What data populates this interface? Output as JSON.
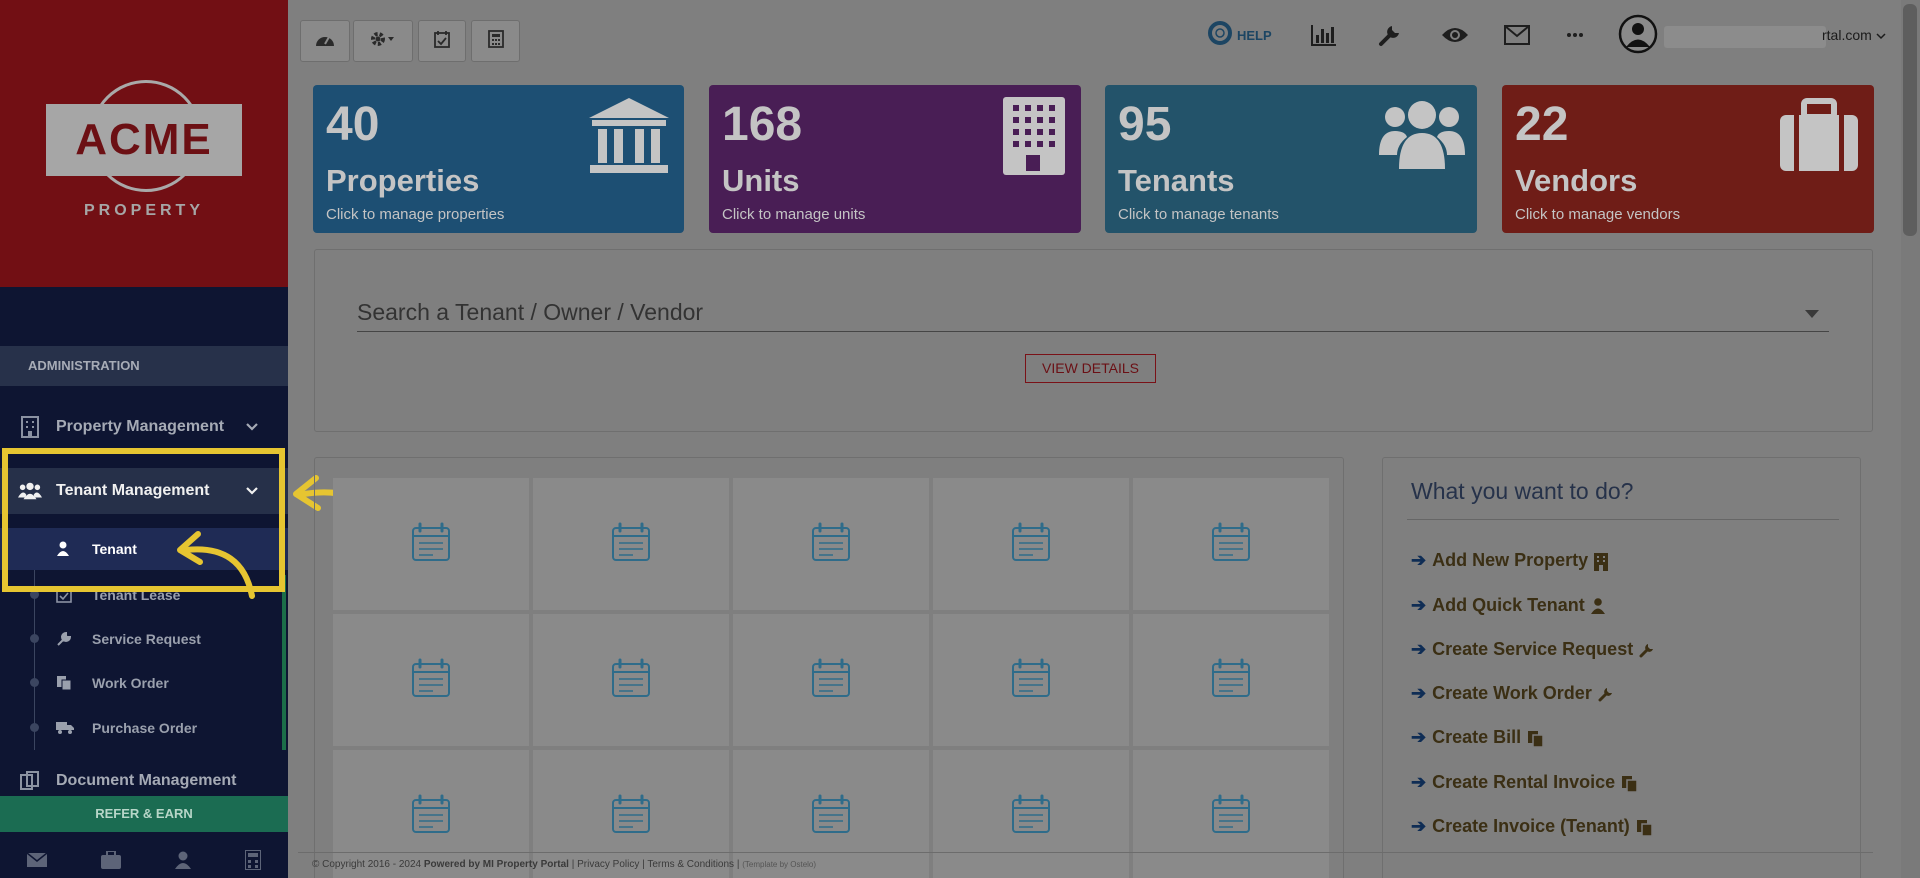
{
  "sidebar": {
    "logo_text": "ACME",
    "logo_sub": "PROPERTY",
    "section_header": "ADMINISTRATION",
    "items": [
      {
        "label": "Property Management"
      },
      {
        "label": "Tenant Management"
      },
      {
        "label": "Document Management"
      }
    ],
    "sub_items": [
      {
        "label": "Tenant"
      },
      {
        "label": "Tenant Lease"
      },
      {
        "label": "Service Request"
      },
      {
        "label": "Work Order"
      },
      {
        "label": "Purchase Order"
      }
    ],
    "refer_label": "REFER & EARN",
    "bottom_icons": [
      "envelope-icon",
      "briefcase-icon",
      "user-icon",
      "calculator-icon"
    ]
  },
  "toolbar": {
    "buttons": [
      "dashboard-icon",
      "gear-dropdown-icon",
      "calendar-check-icon",
      "calculator-icon"
    ]
  },
  "topnav": {
    "help_label": "HELP",
    "icons": [
      "bar-chart-icon",
      "wrench-icon",
      "eye-icon",
      "envelope-icon",
      "more-icon"
    ],
    "email_visible_suffix": "rtal.com"
  },
  "stats": [
    {
      "number": "40",
      "label": "Properties",
      "sub": "Click to manage properties",
      "color": "#1d4f73",
      "icon": "bank-icon"
    },
    {
      "number": "168",
      "label": "Units",
      "sub": "Click to manage units",
      "color": "#491e55",
      "icon": "building-icon"
    },
    {
      "number": "95",
      "label": "Tenants",
      "sub": "Click to manage tenants",
      "color": "#23536a",
      "icon": "users-icon"
    },
    {
      "number": "22",
      "label": "Vendors",
      "sub": "Click to manage vendors",
      "color": "#6f1d17",
      "icon": "suitcase-icon"
    }
  ],
  "search": {
    "placeholder": "Search a Tenant / Owner / Vendor",
    "view_label": "VIEW DETAILS"
  },
  "actions": {
    "title": "What you want to do?",
    "items": [
      {
        "label": "Add New Property",
        "icon": "building-icon"
      },
      {
        "label": "Add Quick Tenant",
        "icon": "user-icon"
      },
      {
        "label": "Create Service Request",
        "icon": "wrench-icon"
      },
      {
        "label": "Create Work Order",
        "icon": "wrench-icon"
      },
      {
        "label": "Create Bill",
        "icon": "copy-icon"
      },
      {
        "label": "Create Rental Invoice",
        "icon": "copy-icon"
      },
      {
        "label": "Create Invoice (Tenant)",
        "icon": "copy-icon"
      }
    ]
  },
  "footer": {
    "copyright": "© Copyright 2016 - 2024",
    "powered": "Powered by MI Property Portal",
    "sep": "|",
    "privacy": "Privacy Policy",
    "terms": "Terms & Conditions",
    "template": "(Template by Ostelo)"
  },
  "colors": {
    "highlight": "#e6c531",
    "accent_red": "#720f14"
  }
}
